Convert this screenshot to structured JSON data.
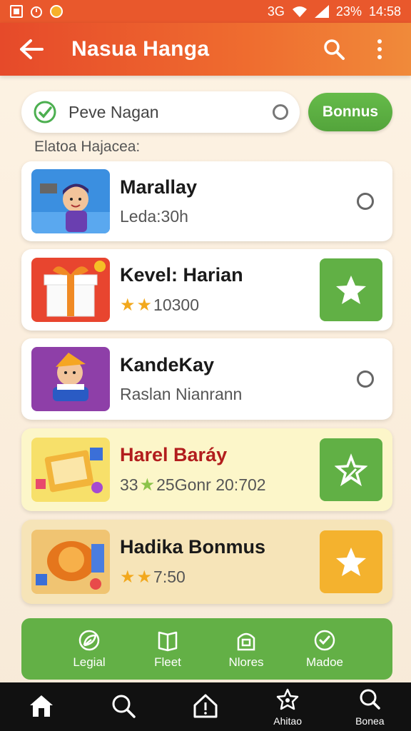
{
  "status_bar": {
    "left_icons": [
      "screenshot-icon",
      "timer-icon",
      "notification-icon"
    ],
    "right_text": "3G",
    "battery": "23%",
    "time": "14:58"
  },
  "app_bar": {
    "title": "Nasua Hanga"
  },
  "search": {
    "value": "Peve Nagan",
    "button_label": "Bonnus"
  },
  "section_label": "Elatoa Hajacea:",
  "cards": [
    {
      "title": "Marallay",
      "sub": "Leda:30h",
      "stars": 0,
      "action": "radio"
    },
    {
      "title": "Kevel: Harian",
      "sub": "10300",
      "stars": 2,
      "action": "star-green"
    },
    {
      "title": "KandeKay",
      "sub": "Raslan Nianrann",
      "stars": 0,
      "action": "radio"
    },
    {
      "title": "Harel Baráy",
      "sub_prefix": "33",
      "sub": "25Gonr 20:702",
      "stars": 1,
      "action": "star-green-outline"
    },
    {
      "title": "Hadika Bonmus",
      "sub": "7:50",
      "stars": 2,
      "action": "star-orange"
    }
  ],
  "strip": [
    {
      "label": "Legial",
      "icon": "leaf-icon"
    },
    {
      "label": "Fleet",
      "icon": "book-icon"
    },
    {
      "label": "Nlores",
      "icon": "lock-icon"
    },
    {
      "label": "Madoe",
      "icon": "check-circle-icon"
    }
  ],
  "bottom_nav": [
    {
      "label": "",
      "icon": "home-icon"
    },
    {
      "label": "",
      "icon": "search-icon"
    },
    {
      "label": "",
      "icon": "alert-home-icon"
    },
    {
      "label": "Ahitao",
      "icon": "badge-icon"
    },
    {
      "label": "Bonea",
      "icon": "search-icon"
    }
  ],
  "colors": {
    "accent": "#e9582c",
    "green": "#61b045",
    "orange": "#f4b22e"
  }
}
